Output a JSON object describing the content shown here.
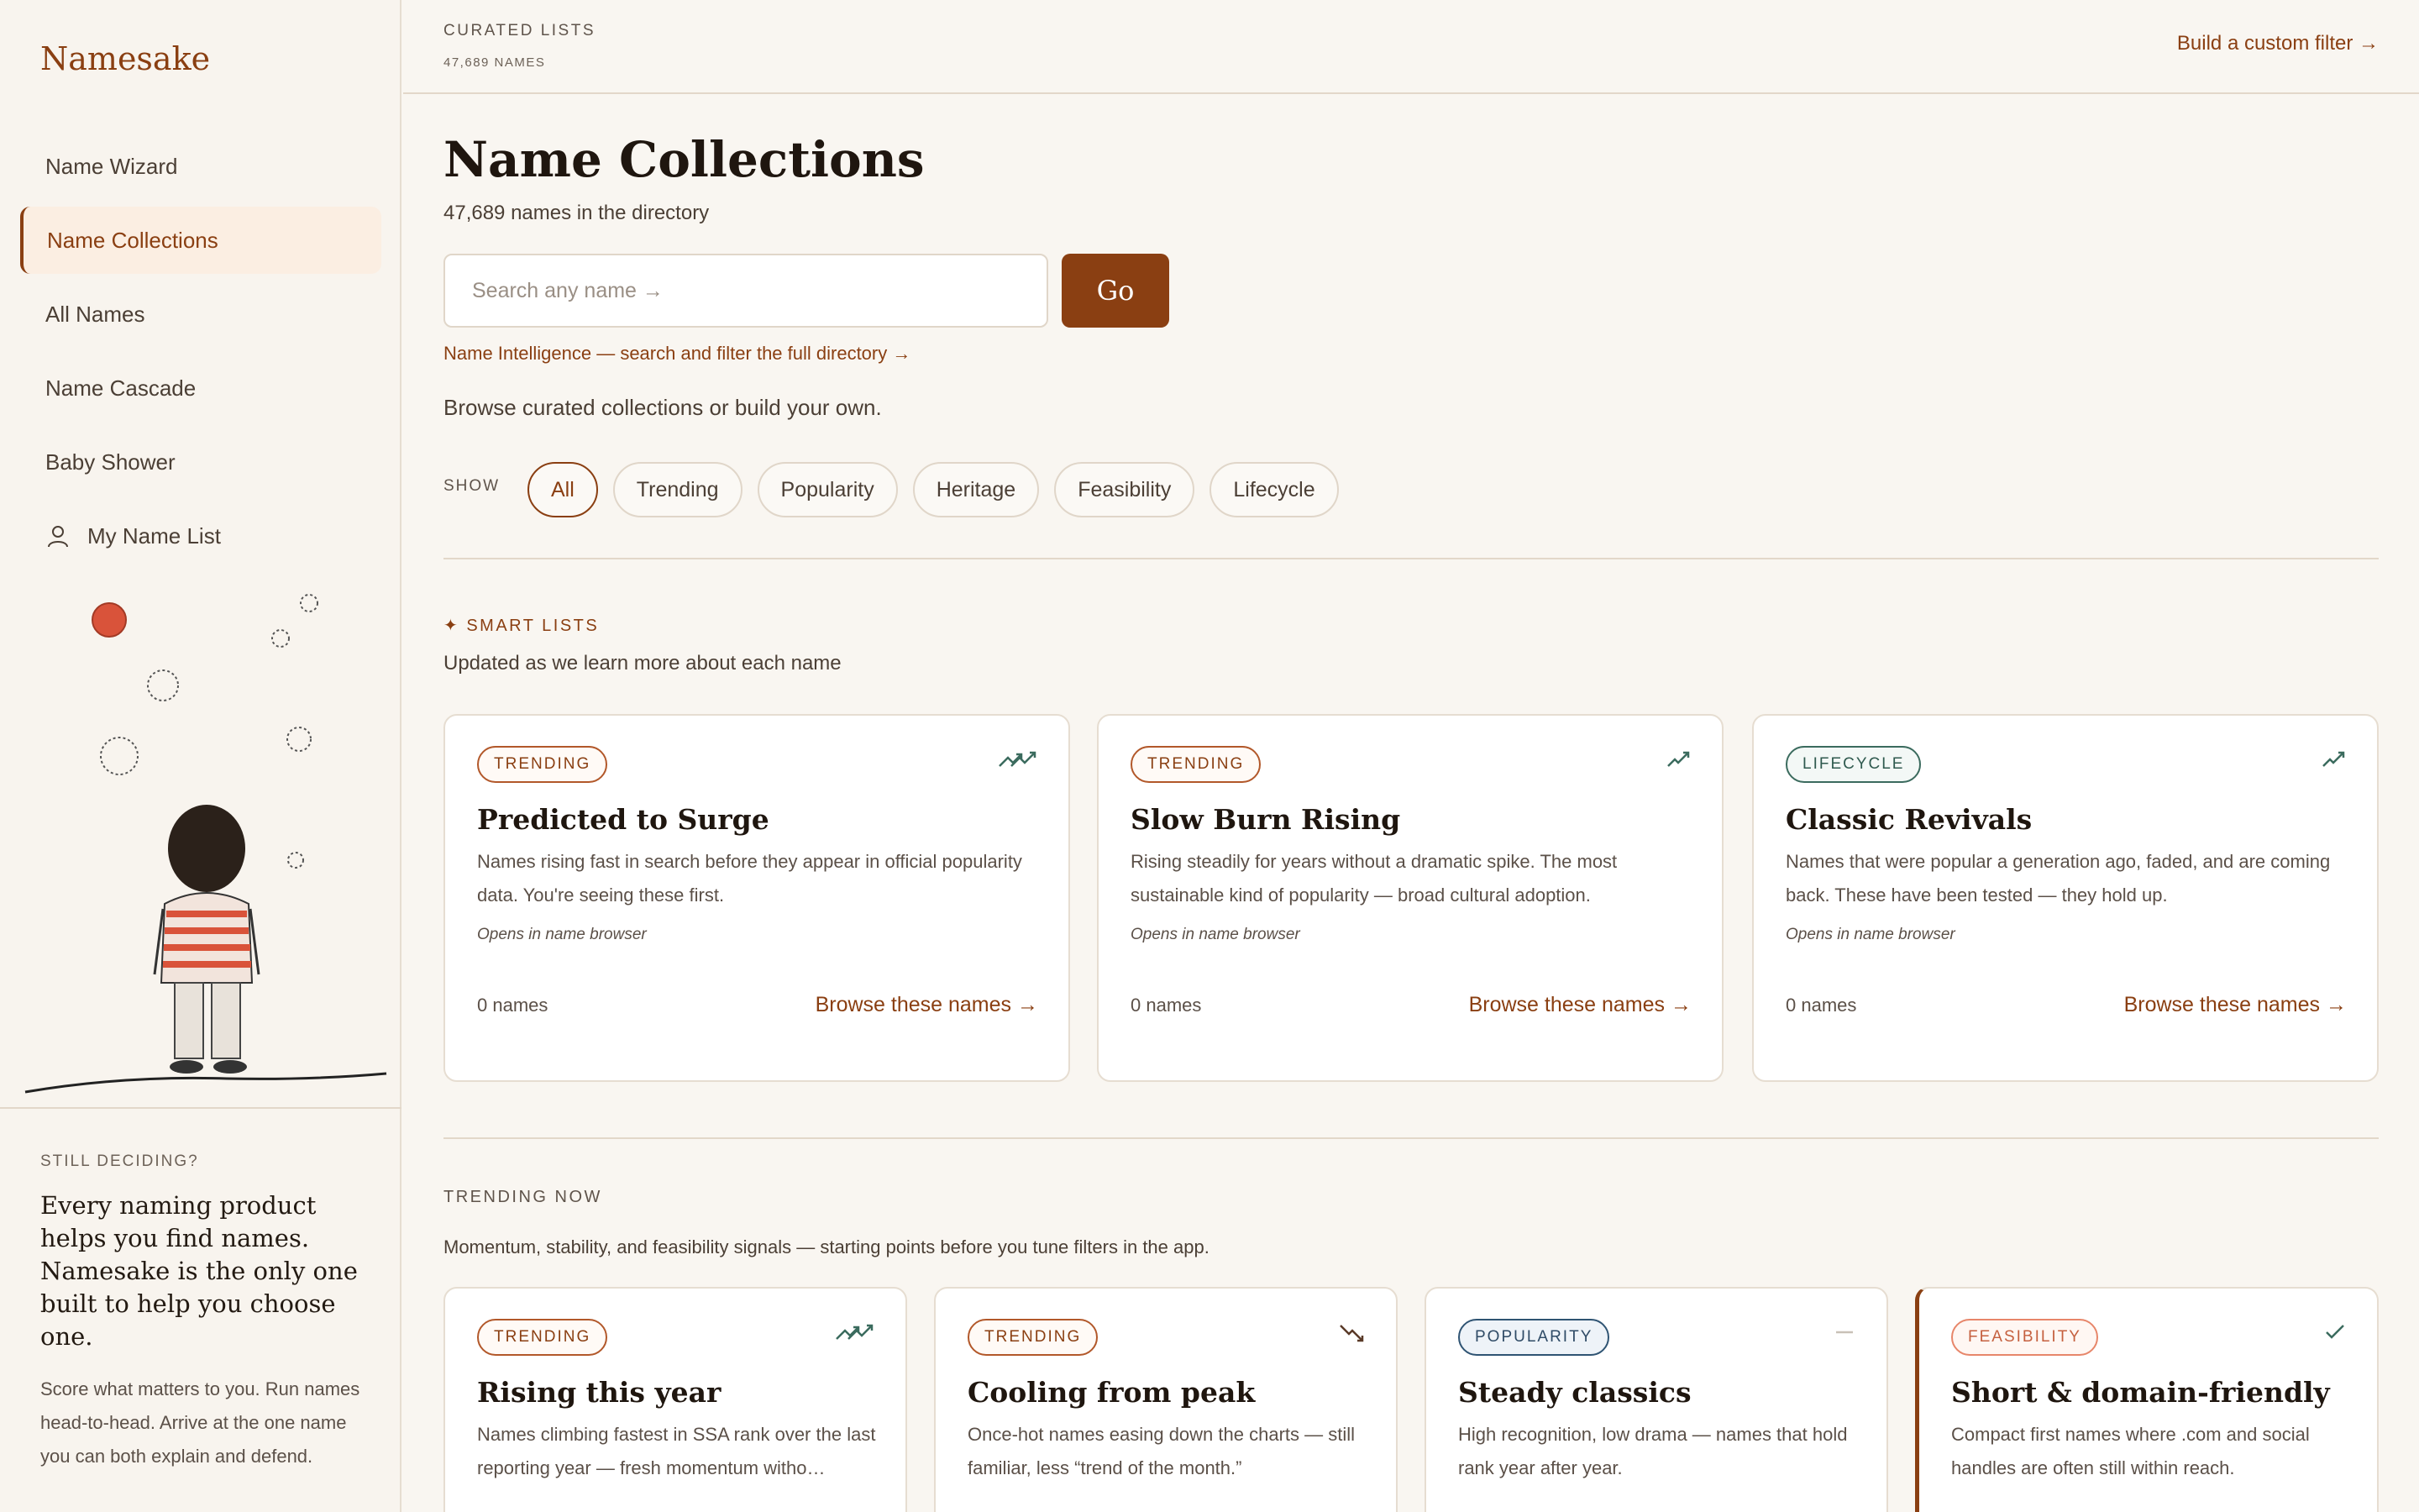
{
  "brand": "Namesake",
  "sidebar": {
    "items": [
      {
        "label": "Name Wizard"
      },
      {
        "label": "Name Collections"
      },
      {
        "label": "All Names"
      },
      {
        "label": "Name Cascade"
      },
      {
        "label": "Baby Shower"
      },
      {
        "label": "My Name List",
        "icon": "user-icon"
      }
    ],
    "active_index": 1,
    "promo": {
      "eyebrow": "STILL DECIDING?",
      "headline": "Every naming product helps you find names. Namesake is the only one built to help you choose one.",
      "body": "Score what matters to you. Run names head-to-head. Arrive at the one name you can both explain and defend."
    }
  },
  "topbar": {
    "eyebrow": "CURATED LISTS",
    "sub": "47,689 NAMES",
    "custom_link": "Build a custom filter →"
  },
  "main": {
    "title": "Name Collections",
    "count": "47,689 names in the directory",
    "search_placeholder": "Search any name →",
    "go_label": "Go",
    "intel_link": "Name Intelligence — search and filter the full directory →",
    "browse_line": "Browse curated collections or build your own.",
    "show_label": "SHOW",
    "chips": [
      "All",
      "Trending",
      "Popularity",
      "Heritage",
      "Feasibility",
      "Lifecycle"
    ],
    "active_chip": "All"
  },
  "smart_lists": {
    "eyebrow": "✦ SMART LISTS",
    "sub": "Updated as we learn more about each name",
    "cards": [
      {
        "badge": "TRENDING",
        "icon": "double-trend-up-icon",
        "title": "Predicted to Surge",
        "desc": "Names rising fast in search before they appear in official popularity data. You're seeing these first.",
        "note": "Opens in name browser",
        "count": "0 names",
        "link": "Browse these names →"
      },
      {
        "badge": "TRENDING",
        "icon": "trend-up-icon",
        "title": "Slow Burn Rising",
        "desc": "Rising steadily for years without a dramatic spike. The most sustainable kind of popularity — broad cultural adoption.",
        "note": "Opens in name browser",
        "count": "0 names",
        "link": "Browse these names →"
      },
      {
        "badge": "LIFECYCLE",
        "icon": "trend-up-icon",
        "title": "Classic Revivals",
        "desc": "Names that were popular a generation ago, faded, and are coming back. These have been tested — they hold up.",
        "note": "Opens in name browser",
        "count": "0 names",
        "link": "Browse these names →"
      }
    ]
  },
  "trending_now": {
    "eyebrow": "TRENDING NOW",
    "sub": "Momentum, stability, and feasibility signals — starting points before you tune filters in the app.",
    "cards": [
      {
        "badge": "TRENDING",
        "icon": "double-trend-up-icon",
        "title": "Rising this year",
        "desc": "Names climbing fastest in SSA rank over the last reporting year — fresh momentum witho…"
      },
      {
        "badge": "TRENDING",
        "icon": "trend-down-icon",
        "title": "Cooling from peak",
        "desc": "Once-hot names easing down the charts — still familiar, less “trend of the month.”"
      },
      {
        "badge": "POPULARITY",
        "icon": "flat-line-icon",
        "title": "Steady classics",
        "desc": "High recognition, low drama — names that hold rank year after year."
      },
      {
        "badge": "FEASIBILITY",
        "icon": "check-icon",
        "title": "Short & domain-friendly",
        "desc": "Compact first names where .com and social handles are often still within reach."
      }
    ]
  },
  "colors": {
    "accent": "#8a3f12",
    "background": "#f9f6f1",
    "teal": "#2f5a4f"
  }
}
